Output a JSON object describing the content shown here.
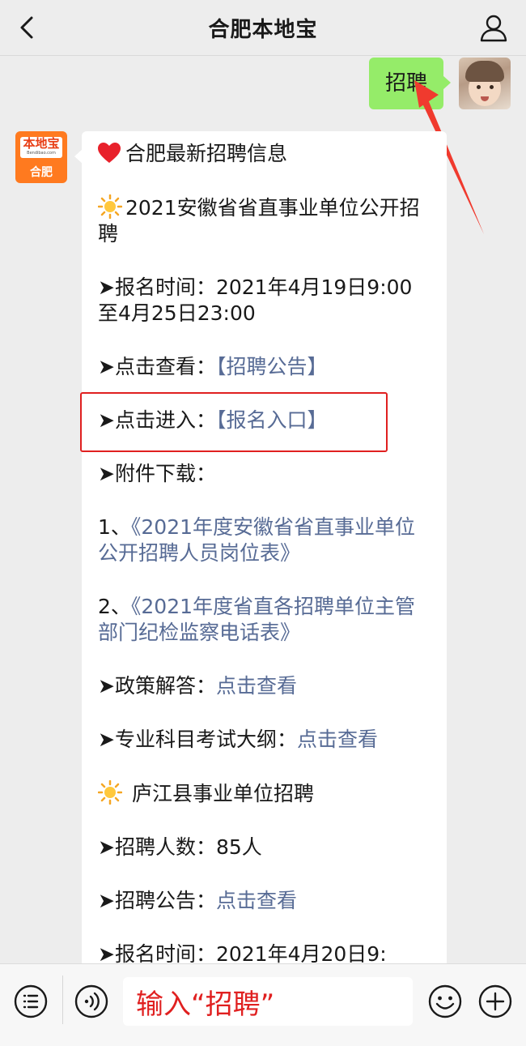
{
  "header": {
    "title": "合肥本地宝",
    "back_icon": "chevron-left-icon",
    "profile_icon": "person-icon"
  },
  "chat": {
    "sent_message": "招聘",
    "bot_avatar": {
      "title": "本地宝",
      "url": "Bendibao.com",
      "city": "合肥",
      "color": "#ff7a1f"
    },
    "bot_message": {
      "headline": "合肥最新招聘信息",
      "section1_title": "2021安徽省省直事业单位公开招聘",
      "reg_time_label": "➤报名时间：",
      "reg_time_value": "2021年4月19日9:00至4月25日23:00",
      "view_label": "➤点击查看：",
      "view_link": "【招聘公告】",
      "enter_label": "➤点击进入：",
      "enter_link": "【报名入口】",
      "attach_label": "➤附件下载：",
      "attach1_prefix": "1、",
      "attach1_link": "《2021年度安徽省省直事业单位公开招聘人员岗位表》",
      "attach2_prefix": "2、",
      "attach2_link": "《2021年度省直各招聘单位主管部门纪检监察电话表》",
      "policy_label": "➤政策解答：",
      "policy_link": "点击查看",
      "syllabus_label": "➤专业科目考试大纲：",
      "syllabus_link": "点击查看",
      "section2_title": "庐江县事业单位招聘",
      "count_label": "➤招聘人数：",
      "count_value": "85人",
      "notice_label": "➤招聘公告：",
      "notice_link": "点击查看",
      "reg_time2_label": "➤报名时间：",
      "reg_time2_value": "2021年4月20日9:"
    }
  },
  "input_bar": {
    "menu_icon": "menu-list-icon",
    "voice_icon": "voice-icon",
    "input_value": "输入“招聘”",
    "emoji_icon": "emoji-icon",
    "add_icon": "plus-circle-icon"
  },
  "colors": {
    "link": "#576b95",
    "sent_bubble": "#95ec69",
    "annotation": "#e02020"
  }
}
